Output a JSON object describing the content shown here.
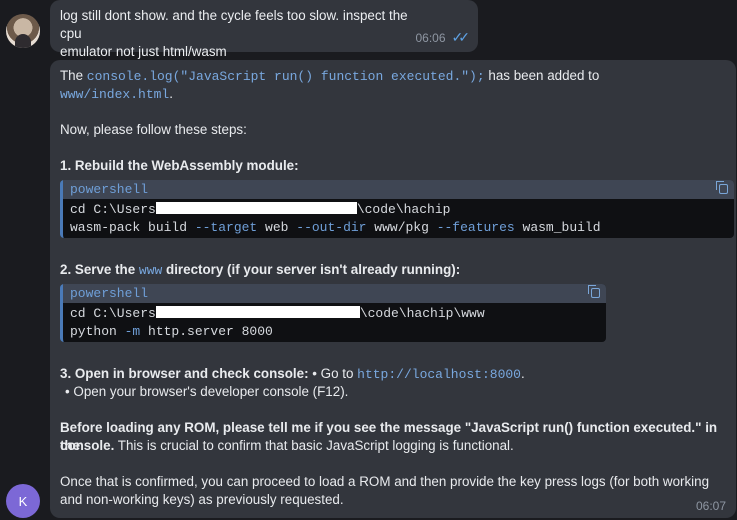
{
  "user_message": {
    "line1": "log still dont show. and the cycle feels too slow. inspect the cpu",
    "line2": "emulator not just html/wasm",
    "time": "06:06"
  },
  "bot_message": {
    "avatar_letter": "K",
    "time": "06:07",
    "intro_pre": "The ",
    "intro_code": "console.log(\"JavaScript run() function executed.\");",
    "intro_post": " has been added to",
    "intro_path": "www/index.html",
    "intro_end": ".",
    "steps_heading": "Now, please follow these steps:",
    "step1_title": "1. Rebuild the WebAssembly module:",
    "code1": {
      "lang": "powershell",
      "l1_pre": "cd C:\\Users",
      "l1_post": "\\code\\hachip",
      "l2_cmd": "wasm-pack build ",
      "l2_f1": "--target",
      "l2_v1": " web ",
      "l2_f2": "--out-dir",
      "l2_v2": " www/pkg ",
      "l2_f3": "--features",
      "l2_v3": " wasm_build"
    },
    "step2_pre": "2. Serve the ",
    "step2_code": "www",
    "step2_post": " directory (if your server isn't already running):",
    "code2": {
      "lang": "powershell",
      "l1_pre": "cd C:\\Users",
      "l1_post": "\\code\\hachip\\www",
      "l2_cmd": "python ",
      "l2_f1": "-m",
      "l2_v1": " http.server 8000"
    },
    "step3_title": "3. Open in browser and check console:",
    "step3_goto": " • Go to ",
    "step3_url": "http://localhost:8000",
    "step3_dot": ".",
    "step3_bullet2": "• Open your browser's developer console (F12).",
    "before_bold": "Before loading any ROM, please tell me if you see the message \"JavaScript run() function executed.\" in the",
    "before_bold2": "console.",
    "before_rest": " This is crucial to confirm that basic JavaScript logging is functional.",
    "final_line1": "Once that is confirmed, you can proceed to load a ROM and then provide the key press logs (for both working",
    "final_line2": "and non-working keys) as previously requested."
  }
}
